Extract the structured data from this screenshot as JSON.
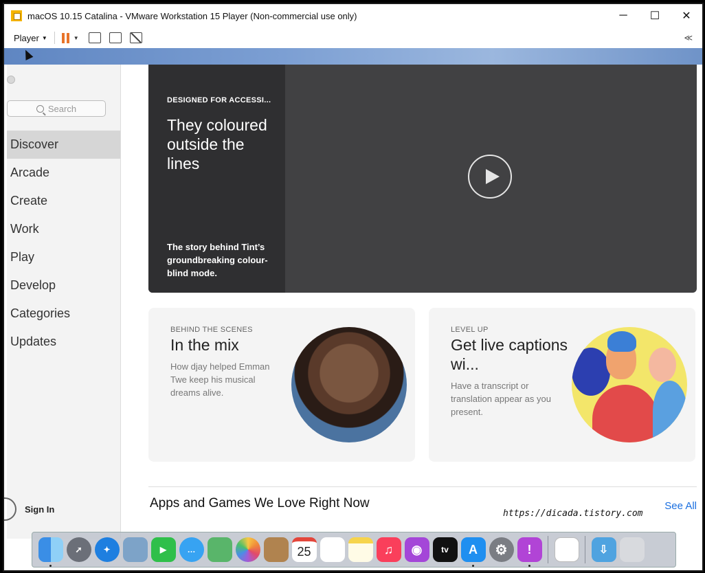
{
  "window": {
    "title": "macOS 10.15 Catalina - VMware Workstation 15 Player (Non-commercial use only)",
    "minimize": "─",
    "maximize": "☐",
    "close": "✕"
  },
  "toolbar": {
    "player_label": "Player",
    "collapse": "≪"
  },
  "sidebar": {
    "search_placeholder": "Search",
    "items": [
      {
        "label": "Discover",
        "active": true
      },
      {
        "label": "Arcade"
      },
      {
        "label": "Create"
      },
      {
        "label": "Work"
      },
      {
        "label": "Play"
      },
      {
        "label": "Develop"
      },
      {
        "label": "Categories"
      },
      {
        "label": "Updates"
      }
    ],
    "sign_in": "Sign In"
  },
  "hero": {
    "eyebrow": "DESIGNED FOR ACCESSI...",
    "title": "They coloured outside the lines",
    "description": "The story behind Tint’s groundbreaking colour-blind mode."
  },
  "cards": [
    {
      "eyebrow": "BEHIND THE SCENES",
      "title": "In the mix",
      "description": "How djay helped Emman Twe keep his musical dreams alive."
    },
    {
      "eyebrow": "LEVEL UP",
      "title": "Get live captions wi...",
      "description": "Have a transcript or translation appear as you present."
    }
  ],
  "section": {
    "title": "Apps and Games We Love Right Now",
    "see_all": "See All"
  },
  "watermark": "https://dicada.tistory.com",
  "dock": {
    "calendar_day": "25",
    "tv_label": "tv",
    "colors": {
      "finder": "#3a8ee6",
      "launchpad": "#6b6f78",
      "safari": "#1e7fe0",
      "facetime": "#2fbf4a",
      "messages": "#37a3f2",
      "maps": "#59b56a",
      "photos": "#f2f2f2",
      "contacts": "#b0834f",
      "calendar": "#ffffff",
      "reminders": "#ffffff",
      "notes": "#f6d44c",
      "music": "#fa3f5b",
      "podcasts": "#a446d8",
      "appletv": "#111111",
      "appstore": "#1f8ff0",
      "preferences": "#7a7d83",
      "feedback": "#b144d6",
      "downloads": "#4fa3e0",
      "trash": "#d8dade"
    }
  }
}
